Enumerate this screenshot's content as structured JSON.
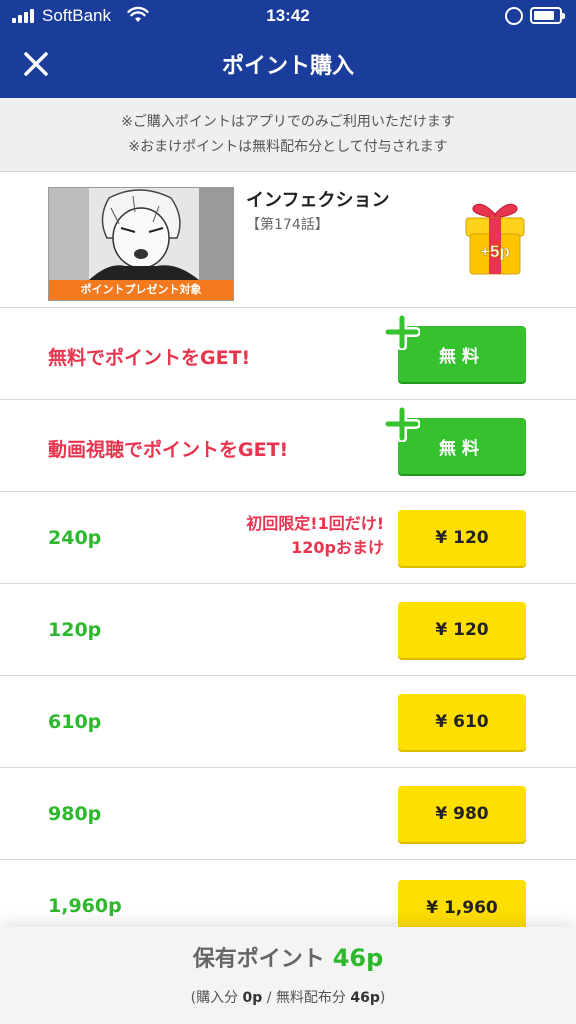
{
  "status_bar": {
    "carrier": "SoftBank",
    "time": "13:42",
    "battery_level": 0.85
  },
  "header": {
    "title": "ポイント購入"
  },
  "notice": {
    "line1": "※ご購入ポイントはアプリでのみご利用いただけます",
    "line2": "※おまけポイントは無料配布分として付与されます"
  },
  "comic": {
    "title": "インフェクション",
    "episode": "【第174話】",
    "thumb_label": "ポイントプレゼント対象",
    "gift_badge": "+5p"
  },
  "free_rows": [
    {
      "label": "無料でポイントをGET!",
      "button": "無料"
    },
    {
      "label": "動画視聴でポイントをGET!",
      "button": "無料"
    }
  ],
  "purchase_rows": [
    {
      "points": "240p",
      "price": "¥ 120",
      "promo_line1": "初回限定!1回だけ!",
      "promo_line2": "120pおまけ"
    },
    {
      "points": "120p",
      "price": "¥ 120"
    },
    {
      "points": "610p",
      "price": "¥ 610"
    },
    {
      "points": "980p",
      "price": "¥ 980"
    },
    {
      "points": "1,960p",
      "price": "¥ 1,960"
    }
  ],
  "footer": {
    "held_label": "保有ポイント",
    "held_value": "46p",
    "breakdown_open": "(",
    "purchased_label": "購入分",
    "purchased_value": "0p",
    "separator": " / ",
    "free_label": "無料配布分",
    "free_value": "46p",
    "breakdown_close": ")"
  },
  "colors": {
    "header_blue": "#1a3c9a",
    "free_green": "#36c22f",
    "price_yellow": "#ffdf00",
    "accent_red": "#e8344e",
    "points_green": "#2db82d",
    "thumb_orange": "#f47a1f"
  }
}
